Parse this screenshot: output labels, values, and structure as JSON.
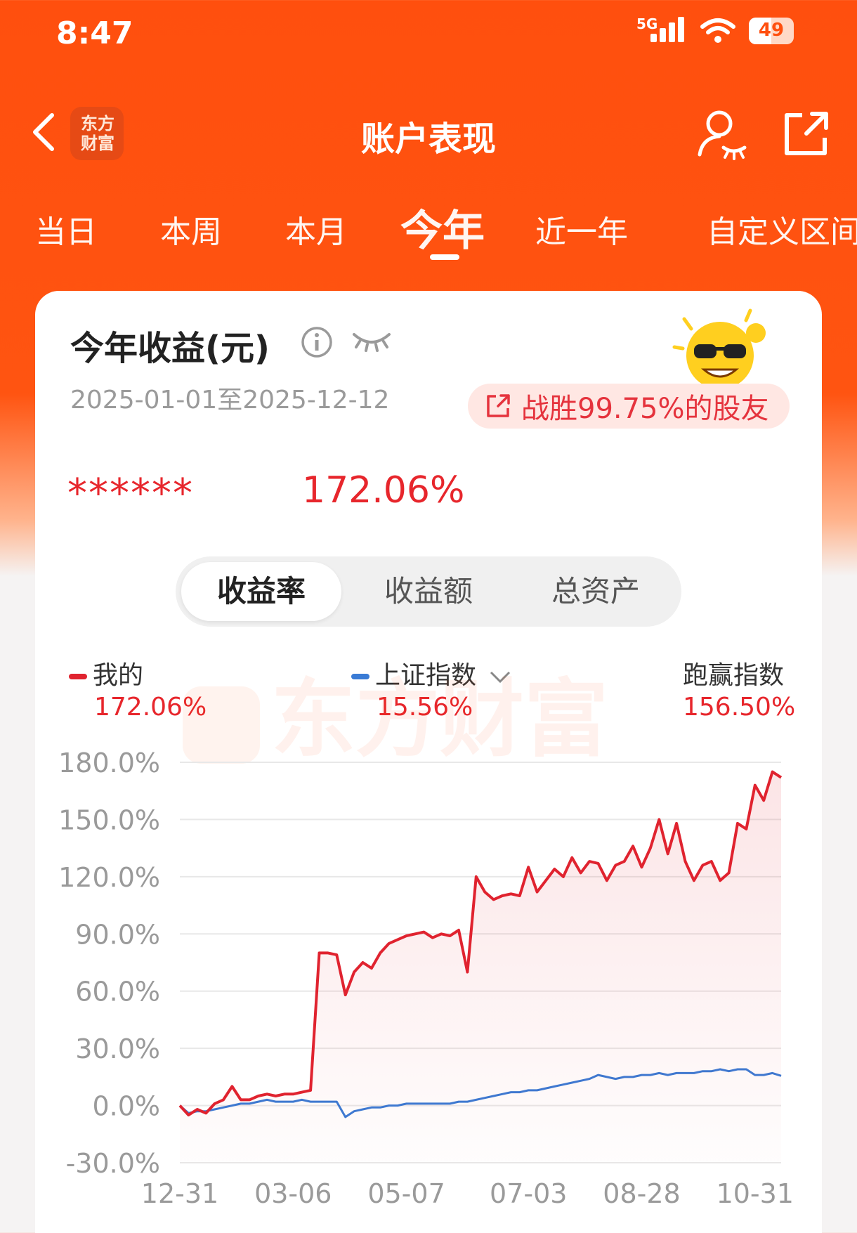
{
  "status_bar": {
    "time": "8:47",
    "network": "5G",
    "battery": "49"
  },
  "nav": {
    "logo_line1": "东方",
    "logo_line2": "财富",
    "title": "账户表现"
  },
  "tabs": [
    {
      "label": "当日"
    },
    {
      "label": "本周"
    },
    {
      "label": "本月"
    },
    {
      "label": "今年",
      "active": true
    },
    {
      "label": "近一年"
    },
    {
      "label": "自定义区间"
    }
  ],
  "card": {
    "title": "今年收益(元)",
    "date_range": "2025-01-01至2025-12-12",
    "beat_text": "战胜99.75%的股友",
    "hidden_amount": "******",
    "return_pct": "172.06%"
  },
  "segments": [
    {
      "label": "收益率",
      "active": true
    },
    {
      "label": "收益额"
    },
    {
      "label": "总资产"
    }
  ],
  "legend": {
    "mine": {
      "label": "我的",
      "value": "172.06%"
    },
    "index": {
      "label": "上证指数",
      "value": "15.56%"
    },
    "beat": {
      "label": "跑赢指数",
      "value": "156.50%"
    }
  },
  "watermark": "东方财富",
  "colors": {
    "brand": "#ff4f0e",
    "mine_line": "#e0232f",
    "index_line": "#3a7bd5",
    "up_text": "#e7262c"
  },
  "chart_data": {
    "type": "line",
    "x_ticks": [
      "12-31",
      "03-06",
      "05-07",
      "07-03",
      "08-28",
      "10-31"
    ],
    "ylim": [
      -30,
      180
    ],
    "y_ticks": [
      "180.0%",
      "150.0%",
      "120.0%",
      "90.0%",
      "60.0%",
      "30.0%",
      "0.0%",
      "-30.0%"
    ],
    "y_tick_values": [
      180,
      150,
      120,
      90,
      60,
      30,
      0,
      -30
    ],
    "series": [
      {
        "name": "我的",
        "color": "#e0232f",
        "values": [
          0,
          -5,
          -2,
          -4,
          1,
          3,
          10,
          3,
          3,
          5,
          6,
          5,
          6,
          6,
          7,
          8,
          80,
          80,
          79,
          58,
          70,
          75,
          72,
          80,
          85,
          87,
          89,
          90,
          91,
          88,
          90,
          89,
          92,
          70,
          120,
          112,
          108,
          110,
          111,
          110,
          125,
          112,
          118,
          124,
          120,
          130,
          122,
          128,
          127,
          118,
          126,
          128,
          136,
          125,
          135,
          150,
          132,
          148,
          128,
          118,
          126,
          128,
          118,
          122,
          148,
          145,
          168,
          160,
          175,
          172
        ]
      },
      {
        "name": "上证指数",
        "color": "#3a7bd5",
        "values": [
          0,
          -4,
          -3,
          -3,
          -2,
          -1,
          0,
          1,
          1,
          2,
          3,
          2,
          2,
          2,
          3,
          2,
          2,
          2,
          2,
          -6,
          -3,
          -2,
          -1,
          -1,
          0,
          0,
          1,
          1,
          1,
          1,
          1,
          1,
          2,
          2,
          3,
          4,
          5,
          6,
          7,
          7,
          8,
          8,
          9,
          10,
          11,
          12,
          13,
          14,
          16,
          15,
          14,
          15,
          15,
          16,
          16,
          17,
          16,
          17,
          17,
          17,
          18,
          18,
          19,
          18,
          19,
          19,
          16,
          16,
          17,
          15.56
        ]
      }
    ]
  }
}
